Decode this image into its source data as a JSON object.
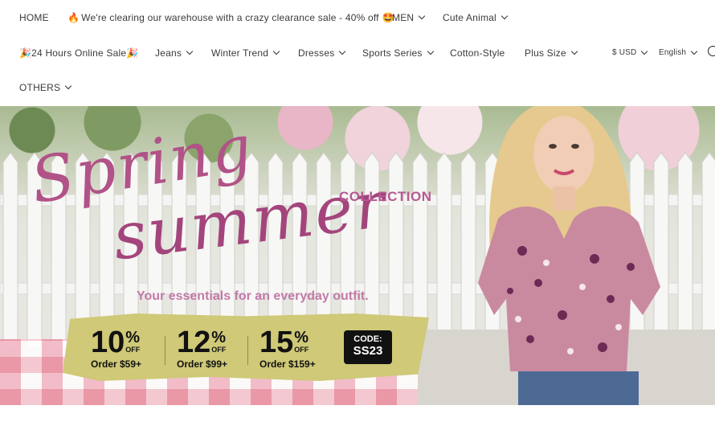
{
  "nav": {
    "home": "HOME",
    "announcement": "We're clearing our warehouse with a crazy clearance sale - 40% off",
    "announcement_lead_emoji": "🔥",
    "announcement_tail_emoji": "🤩",
    "men": "MEN",
    "cute_animal": "Cute Animal",
    "online_sale": "24 Hours Online Sale",
    "online_sale_emoji": "🎉",
    "jeans": "Jeans",
    "winter_trend": "Winter Trend",
    "dresses": "Dresses",
    "sports_series": "Sports Series",
    "cotton_style": "Cotton-Style",
    "plus_size": "Plus Size",
    "currency": "$ USD",
    "language": "English",
    "others": "OTHERS"
  },
  "hero": {
    "script_line1": "Spring",
    "script_line2": "summer",
    "collection": "COLLECTION",
    "tagline": "Your essentials for an everyday outfit.",
    "offers": [
      {
        "pct": "10",
        "sign": "%",
        "off": "OFF",
        "order": "Order $59+"
      },
      {
        "pct": "12",
        "sign": "%",
        "off": "OFF",
        "order": "Order $99+"
      },
      {
        "pct": "15",
        "sign": "%",
        "off": "OFF",
        "order": "Order $159+"
      }
    ],
    "code_label": "CODE:",
    "code_value": "SS23"
  },
  "colors": {
    "accent_pink": "#b15288",
    "strip_yellow": "#cfc978",
    "code_bg": "#111111"
  }
}
